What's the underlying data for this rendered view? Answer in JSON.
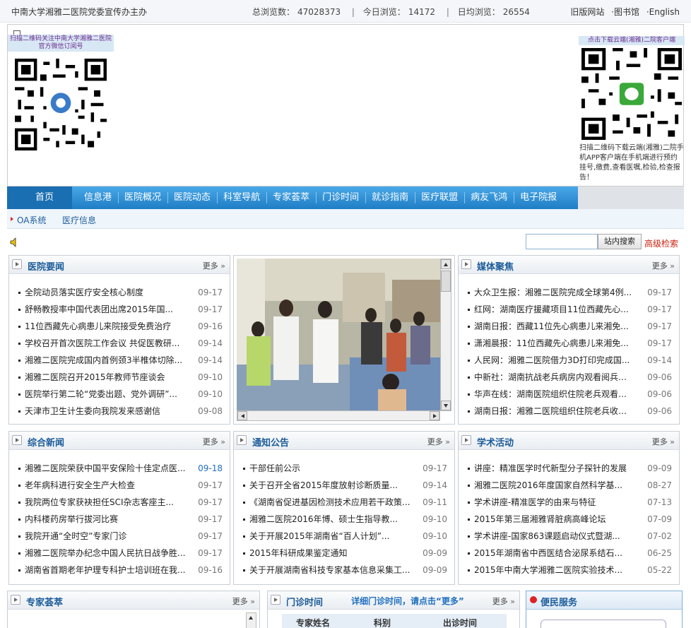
{
  "topbar": {
    "site": "中南大学湘雅二医院党委宣传办主办",
    "total_label": "总浏览数：",
    "total_value": "47028373",
    "today_label": "今日浏览：",
    "today_value": "14172",
    "avg_label": "日均浏览：",
    "avg_value": "26554",
    "links": [
      "旧版网站",
      "·图书馆",
      "·English"
    ]
  },
  "banner": {
    "qr_left_caption": "扫描二维码关注中南大学湘雅二医院官方微信订阅号",
    "qr_right_caption": "点击下载云端(湘雅)二院客户端",
    "qr_right_desc": "扫描二维码下载云端(湘雅)二院手机APP客户端在手机端进行预约挂号,缴费,查看医嘱,检验,检查报告！"
  },
  "nav": {
    "items": [
      "首页",
      "信息港",
      "医院概况",
      "医院动态",
      "科室导航",
      "专家荟萃",
      "门诊时间",
      "就诊指南",
      "医疗联盟",
      "病友飞鸿",
      "电子院报"
    ]
  },
  "subnav": {
    "items": [
      "OA系统",
      "医疗信息"
    ]
  },
  "search": {
    "placeholder": "",
    "button": "站内搜索",
    "advanced": "高级检索"
  },
  "panels": {
    "hospital_news": {
      "title": "医院要闻",
      "more": "更多",
      "items": [
        {
          "t": "全院动员落实医疗安全核心制度",
          "d": "09-17"
        },
        {
          "t": "舒畅教授率中国代表团出席2015年国...",
          "d": "09-17"
        },
        {
          "t": "11位西藏先心病患儿来院接受免费治疗",
          "d": "09-16"
        },
        {
          "t": "学校召开首次医院工作会议 共促医教研...",
          "d": "09-14"
        },
        {
          "t": "湘雅二医院完成国内首例颈3半椎体切除...",
          "d": "09-14"
        },
        {
          "t": "湘雅二医院召开2015年教师节座谈会",
          "d": "09-10"
        },
        {
          "t": "医院举行第二轮“党委出题、党外调研”...",
          "d": "09-10"
        },
        {
          "t": "天津市卫生计生委向我院发来感谢信",
          "d": "09-08"
        }
      ]
    },
    "media": {
      "title": "媒体聚焦",
      "more": "更多",
      "items": [
        {
          "t": "大众卫生报：湘雅二医院完成全球第4例...",
          "d": "09-17"
        },
        {
          "t": "红网：湖南医疗援藏项目11位西藏先心...",
          "d": "09-17"
        },
        {
          "t": "湖南日报：西藏11位先心病患儿来湘免...",
          "d": "09-17"
        },
        {
          "t": "潇湘晨报：11位西藏先心病患儿来湘免...",
          "d": "09-17"
        },
        {
          "t": "人民网：湘雅二医院借力3D打印完成国...",
          "d": "09-14"
        },
        {
          "t": "中新社：湖南抗战老兵病房内观看阅兵仪...",
          "d": "09-06"
        },
        {
          "t": "华声在线：湖南医院组织住院老兵观看阅...",
          "d": "09-06"
        },
        {
          "t": "湖南日报：湘雅二医院组织住院老兵收看...",
          "d": "09-06"
        }
      ]
    },
    "general_news": {
      "title": "综合新闻",
      "more": "更多",
      "items": [
        {
          "t": "湘雅二医院荣获中国平安保险十佳定点医...",
          "d": "09-18"
        },
        {
          "t": "老年病科进行安全生产大检查",
          "d": "09-17"
        },
        {
          "t": "我院两位专家获袂担任SCI杂志客座主...",
          "d": "09-17"
        },
        {
          "t": "内科楼药房举行拔河比赛",
          "d": "09-17"
        },
        {
          "t": "我院开通“全时空”专家门诊",
          "d": "09-17"
        },
        {
          "t": "湘雅二医院举办纪念中国人民抗日战争胜...",
          "d": "09-17"
        },
        {
          "t": "湖南省首期老年护理专科护士培训班在我...",
          "d": "09-16"
        }
      ]
    },
    "notices": {
      "title": "通知公告",
      "more": "更多",
      "items": [
        {
          "t": "干部任前公示",
          "d": "09-17"
        },
        {
          "t": "关于召开全省2015年度放射诊断质量...",
          "d": "09-14"
        },
        {
          "t": "《湖南省促进基因检测技术应用若干政策...",
          "d": "09-11"
        },
        {
          "t": "湘雅二医院2016年博、硕士生指导教...",
          "d": "09-10"
        },
        {
          "t": "关于开展2015年湖南省“百人计划”...",
          "d": "09-10"
        },
        {
          "t": "2015年科研成果鉴定通知",
          "d": "09-09"
        },
        {
          "t": "关于开展湖南省科技专家基本信息采集工...",
          "d": "09-09"
        }
      ]
    },
    "academic": {
      "title": "学术活动",
      "more": "更多",
      "items": [
        {
          "t": "讲座：精准医学时代新型分子探针的发展",
          "d": "09-09"
        },
        {
          "t": "湘雅二医院2016年度国家自然科学基...",
          "d": "08-27"
        },
        {
          "t": "学术讲座-精准医学的由来与特征",
          "d": "07-13"
        },
        {
          "t": "2015年第三届湘雅肾脏病高峰论坛",
          "d": "07-09"
        },
        {
          "t": "学术讲座-国家863课题启动仪式暨湖...",
          "d": "07-02"
        },
        {
          "t": "2015年湖南省中西医结合泌尿系结石...",
          "d": "06-25"
        },
        {
          "t": "2015年中南大学湘雅二医院实验技术...",
          "d": "05-22"
        }
      ]
    },
    "experts": {
      "title": "专家荟萃",
      "more": "更多"
    },
    "clinic": {
      "title": "门诊时间",
      "more": "更多",
      "detail": "详细门诊时间，请点击“更多”",
      "cols": [
        "专家姓名",
        "科别",
        "出诊时间"
      ]
    },
    "service": {
      "title": "便民服务"
    }
  }
}
